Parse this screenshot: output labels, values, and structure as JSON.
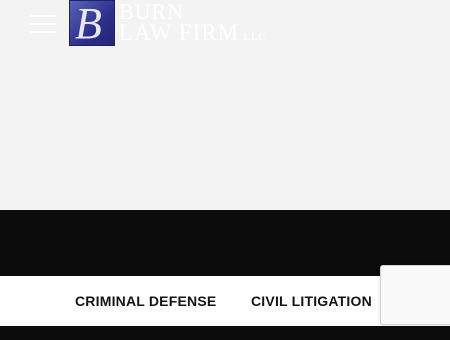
{
  "header": {
    "menu_icon": "hamburger-menu-icon",
    "logo": {
      "badge_letter": "B",
      "line1": "BURN",
      "line2": "LAW FIRM",
      "suffix": "LLC",
      "badge_color": "#2d2f8a"
    }
  },
  "practice_areas": {
    "items": [
      {
        "label": "CRIMINAL DEFENSE"
      },
      {
        "label": "CIVIL LITIGATION"
      }
    ]
  },
  "colors": {
    "page_background": "#f3f3f3",
    "band_background": "#0c0c0c",
    "bar_background": "#ffffff",
    "bar_text": "#141414"
  }
}
